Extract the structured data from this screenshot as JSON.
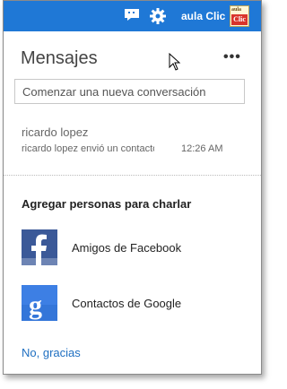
{
  "header": {
    "chat_icon": "chat-bubble-icon",
    "settings_icon": "gear-icon",
    "username": "aula Clic",
    "avatar": {
      "line1": "aula",
      "line2": "Clic"
    },
    "accent_color": "#1f78d6"
  },
  "panel": {
    "title": "Mensajes",
    "more_label": "•••",
    "search_placeholder": "Comenzar una nueva conversación"
  },
  "conversation": {
    "name": "ricardo lopez",
    "preview": "ricardo lopez envió un contacto",
    "time": "12:26 AM"
  },
  "add_people": {
    "title": "Agregar personas para charlar",
    "providers": [
      {
        "label": "Amigos de Facebook",
        "icon": "facebook-icon",
        "color": "#3b5998"
      },
      {
        "label": "Contactos de Google",
        "icon": "google-icon",
        "color": "#3d7fe4"
      }
    ],
    "decline_label": "No, gracias"
  }
}
